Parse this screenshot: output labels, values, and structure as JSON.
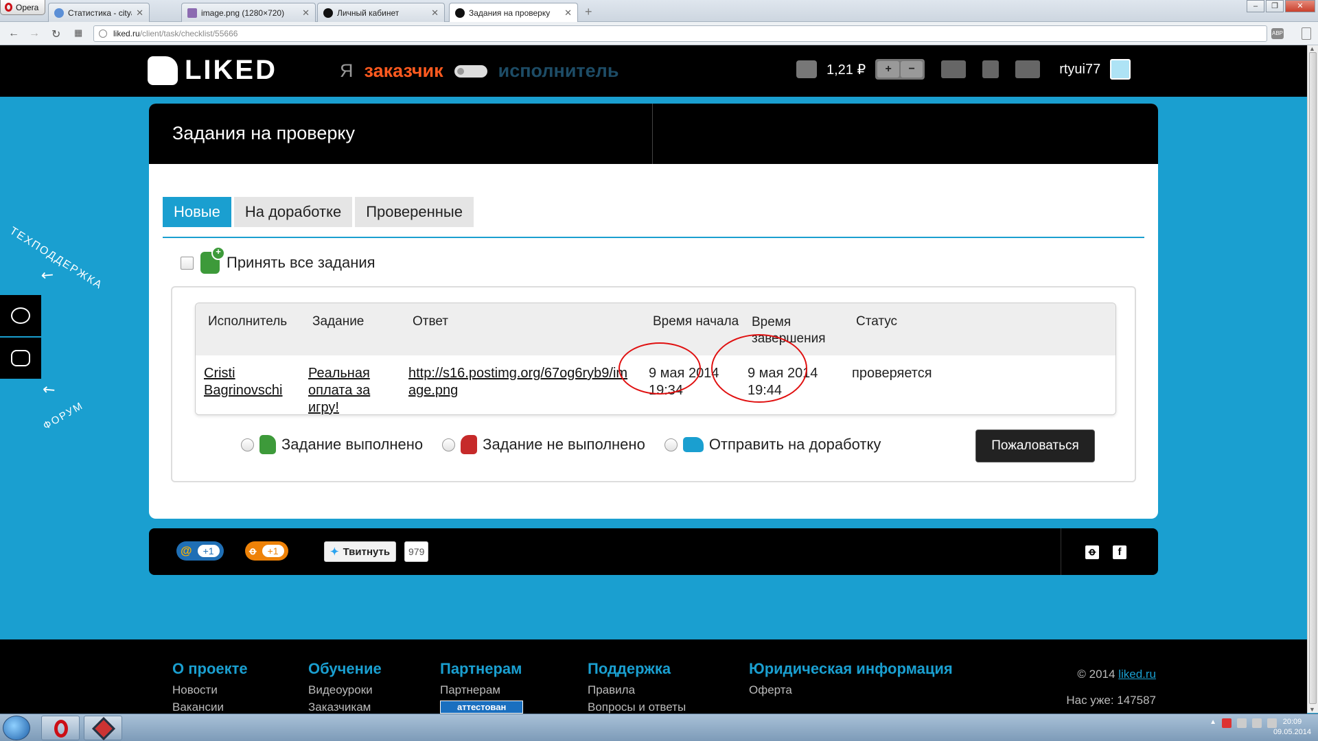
{
  "browser": {
    "menu_label": "Opera",
    "tabs": [
      {
        "title": "Статистика - cityads",
        "fav": "#5b8fd6"
      },
      {
        "title": "image.png (1280×720)",
        "fav": "#8c6bb1"
      },
      {
        "title": "Личный кабинет",
        "fav": "#111111"
      },
      {
        "title": "Задания на проверку",
        "fav": "#111111"
      }
    ],
    "url_host": "liked.ru",
    "url_path": "/client/task/checklist/55666",
    "adblock_label": "ABP"
  },
  "header": {
    "logo_text": "LIKED",
    "role_me": "Я",
    "role_client": "заказчик",
    "role_contractor": "исполнитель",
    "balance": "1,21 ₽",
    "plus": "+",
    "minus": "−",
    "username": "rtyui77"
  },
  "side": {
    "support_label": "ТЕХПОДДЕРЖКА",
    "forum_label": "ФОРУМ"
  },
  "page": {
    "title": "Задания на проверку",
    "tabs": [
      "Новые",
      "На доработке",
      "Проверенные"
    ],
    "accept_all": "Принять все задания"
  },
  "table": {
    "headers": [
      "Исполнитель",
      "Задание",
      "Ответ",
      "Время начала",
      "Время завершения",
      "Статус"
    ],
    "row": {
      "performer": "Cristi Bagrinovschi",
      "task": "Реальная оплата за игру!",
      "answer": "http://s16.postimg.org/67og6ryb9/image.png",
      "start": "9 мая 2014 19:34",
      "end": "9 мая 2014 19:44",
      "status": "проверяется"
    }
  },
  "actions": {
    "done": "Задание выполнено",
    "not_done": "Задание не выполнено",
    "rework": "Отправить на доработку",
    "complain": "Пожаловаться"
  },
  "share": {
    "mail_count": "+1",
    "ok_count": "+1",
    "tweet": "Твитнуть",
    "tweet_count": "979"
  },
  "footer": {
    "cols": [
      {
        "h": "О проекте",
        "items": [
          "Новости",
          "Вакансии"
        ]
      },
      {
        "h": "Обучение",
        "items": [
          "Видеоуроки",
          "Заказчикам"
        ]
      },
      {
        "h": "Партнерам",
        "items": [
          "Партнерам"
        ],
        "badge": "аттестован"
      },
      {
        "h": "Поддержка",
        "items": [
          "Правила",
          "Вопросы и ответы"
        ]
      },
      {
        "h": "Юридическая информация",
        "items": [
          "Оферта"
        ]
      }
    ],
    "copyright_prefix": "© 2014",
    "copyright_link": "liked.ru",
    "users": "Нас уже: 147587"
  },
  "taskbar": {
    "time": "20:09",
    "date": "09.05.2014"
  },
  "colors": {
    "accent": "#1a9fd0",
    "client": "#ff5a1f",
    "ring": "#e01010"
  }
}
